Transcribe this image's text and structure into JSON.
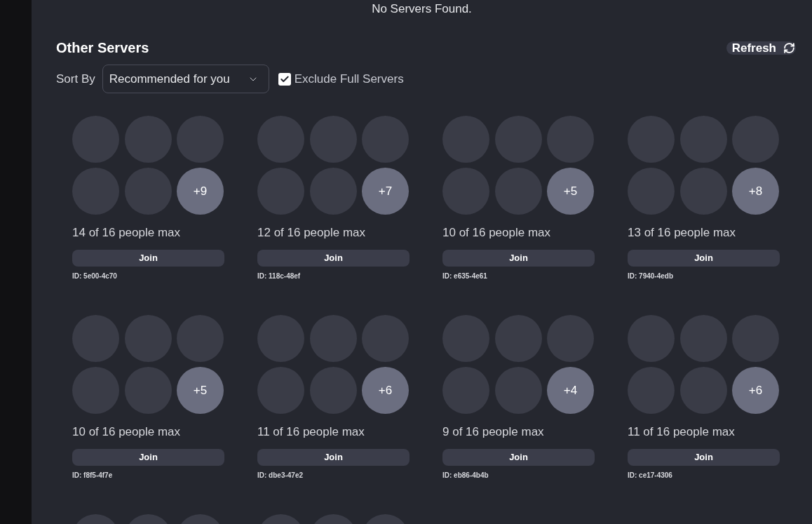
{
  "empty_notice": "No Servers Found.",
  "section": {
    "title": "Other Servers",
    "refresh": "Refresh"
  },
  "sort": {
    "label": "Sort By",
    "value": "Recommended for you"
  },
  "exclude_full": {
    "label": "Exclude Full Servers",
    "checked": true
  },
  "servers": [
    {
      "kind": "server",
      "more": "+9",
      "occupancy": "14 of 16 people max",
      "join": "Join",
      "id": "ID: 5e00-4c70"
    },
    {
      "kind": "server",
      "more": "+7",
      "occupancy": "12 of 16 people max",
      "join": "Join",
      "id": "ID: 118c-48ef"
    },
    {
      "kind": "server",
      "more": "+5",
      "occupancy": "10 of 16 people max",
      "join": "Join",
      "id": "ID: e635-4e61"
    },
    {
      "kind": "server",
      "more": "+8",
      "occupancy": "13 of 16 people max",
      "join": "Join",
      "id": "ID: 7940-4edb"
    },
    {
      "kind": "server",
      "more": "+5",
      "occupancy": "10 of 16 people max",
      "join": "Join",
      "id": "ID: f8f5-4f7e"
    },
    {
      "kind": "server",
      "more": "+6",
      "occupancy": "11 of 16 people max",
      "join": "Join",
      "id": "ID: dbe3-47e2"
    },
    {
      "kind": "server",
      "more": "+4",
      "occupancy": "9 of 16 people max",
      "join": "Join",
      "id": "ID: eb86-4b4b"
    },
    {
      "kind": "server",
      "more": "+6",
      "occupancy": "11 of 16 people max",
      "join": "Join",
      "id": "ID: ce17-4306"
    },
    {
      "kind": "cut_off"
    },
    {
      "kind": "cut_off"
    }
  ]
}
